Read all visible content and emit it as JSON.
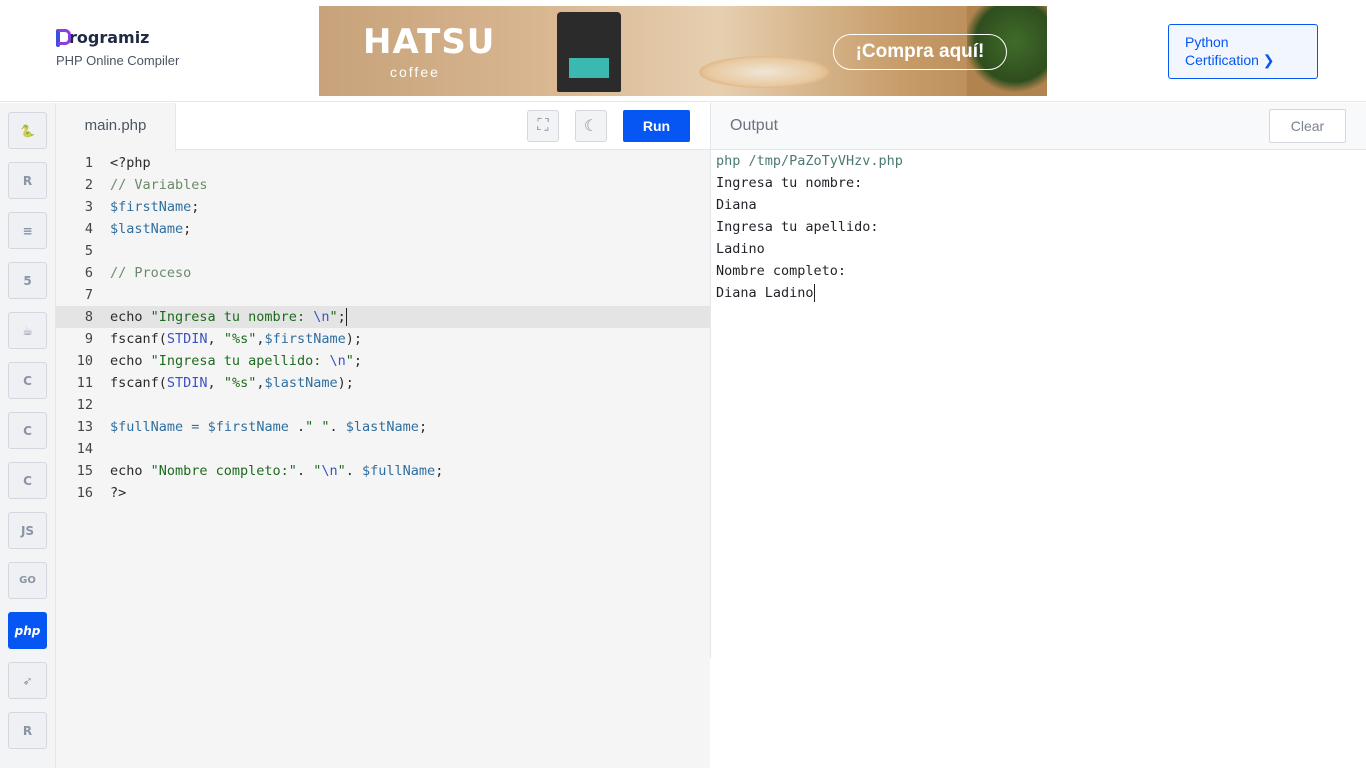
{
  "header": {
    "logo_text": "rogramiz",
    "subtitle": "PHP Online Compiler",
    "ad": {
      "brand": "HATSU",
      "sub": "coffee",
      "cta": "¡Compra aquí!"
    },
    "cert_line1": "Python",
    "cert_line2": "Certification ❯"
  },
  "sidebar": {
    "languages": [
      {
        "name": "python",
        "glyph": "🐍",
        "active": false
      },
      {
        "name": "r",
        "glyph": "R",
        "active": false
      },
      {
        "name": "sql",
        "glyph": "≡",
        "active": false
      },
      {
        "name": "html",
        "glyph": "5",
        "active": false
      },
      {
        "name": "java",
        "glyph": "☕",
        "active": false
      },
      {
        "name": "c",
        "glyph": "C",
        "active": false
      },
      {
        "name": "cpp",
        "glyph": "C",
        "active": false
      },
      {
        "name": "csharp",
        "glyph": "C",
        "active": false
      },
      {
        "name": "javascript",
        "glyph": "JS",
        "active": false
      },
      {
        "name": "go",
        "glyph": "GO",
        "active": false
      },
      {
        "name": "php",
        "glyph": "php",
        "active": true
      },
      {
        "name": "swift",
        "glyph": "➶",
        "active": false
      },
      {
        "name": "rust",
        "glyph": "R",
        "active": false
      }
    ]
  },
  "editor": {
    "file_tab": "main.php",
    "run_label": "Run",
    "fullscreen_glyph": "⛶",
    "theme_glyph": "☾",
    "line_numbers": [
      "1",
      "2",
      "3",
      "4",
      "5",
      "6",
      "7",
      "8",
      "9",
      "10",
      "11",
      "12",
      "13",
      "14",
      "15",
      "16"
    ]
  },
  "output": {
    "title": "Output",
    "clear_label": "Clear",
    "lines": [
      "php /tmp/PaZoTyVHzv.php",
      "Ingresa tu nombre:",
      "Diana",
      "Ingresa tu apellido:",
      "Ladino",
      "Nombre completo:",
      "Diana Ladino"
    ]
  }
}
